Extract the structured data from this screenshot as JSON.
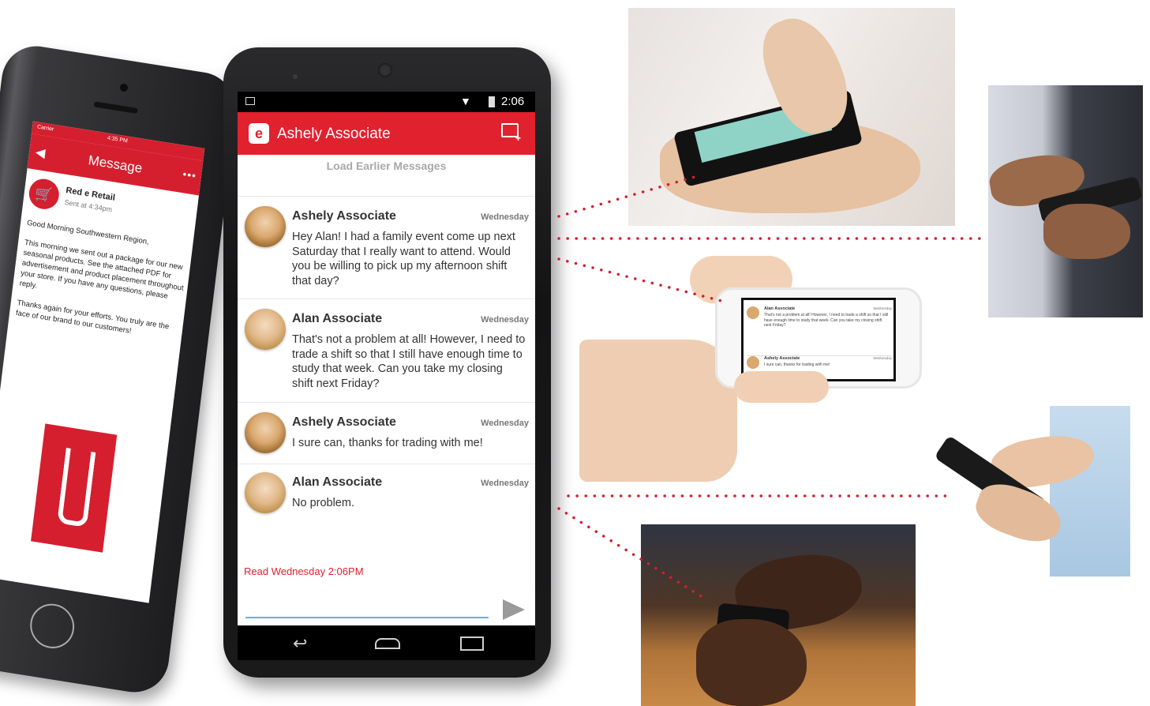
{
  "iphone": {
    "carrier": "Carrier",
    "time": "4:35 PM",
    "nav_title": "Message",
    "back_glyph": "◀",
    "more_glyph": "•••",
    "sender": "Red e Retail",
    "sent_at": "Sent at 4:34pm",
    "paragraphs": [
      "Good Morning Southwestern Region,",
      "This morning we sent out a package for our new seasonal products. See the attached PDF for advertisement and product placement throughout your store. If you have any questions, please reply.",
      "Thanks again for your efforts. You truly are the face of our brand to our customers!"
    ],
    "avatar_icon": "shopping-cart-icon",
    "brand_color": "#d51f2f"
  },
  "android": {
    "status_time": "2:06",
    "app_title": "Ashely Associate",
    "load_earlier": "Load Earlier Messages",
    "messages": [
      {
        "name": "Ashely Associate",
        "day": "Wednesday",
        "text": "Hey Alan! I had a family event come up next Saturday that I really want to attend. Would you be willing to pick up my afternoon shift that day?"
      },
      {
        "name": "Alan Associate",
        "day": "Wednesday",
        "text": "That's not a problem at all! However, I need to trade a shift so that I still have enough time to study that week. Can you take my closing shift next Friday?"
      },
      {
        "name": "Ashely Associate",
        "day": "Wednesday",
        "text": "I sure can, thanks for trading with me!"
      },
      {
        "name": "Alan Associate",
        "day": "Wednesday",
        "text": "No problem."
      }
    ],
    "read_receipt": "Read Wednesday 2:06PM",
    "brand_color": "#e2212f",
    "input_line_color": "#5bb7d8",
    "nav": {
      "back_glyph": "↩",
      "home_icon": "home-icon",
      "recent_icon": "recent-apps-icon"
    }
  },
  "mini_phone": {
    "messages": [
      {
        "name": "Alan Associate",
        "day": "Wednesday",
        "text": "That's not a problem at all! However, I need to trade a shift so that I still have enough time to study that week. Can you take my closing shift next Friday?"
      },
      {
        "name": "Ashely Associate",
        "day": "Wednesday",
        "text": "I sure can, thanks for trading with me!"
      }
    ]
  },
  "connector_color": "#d0202e"
}
